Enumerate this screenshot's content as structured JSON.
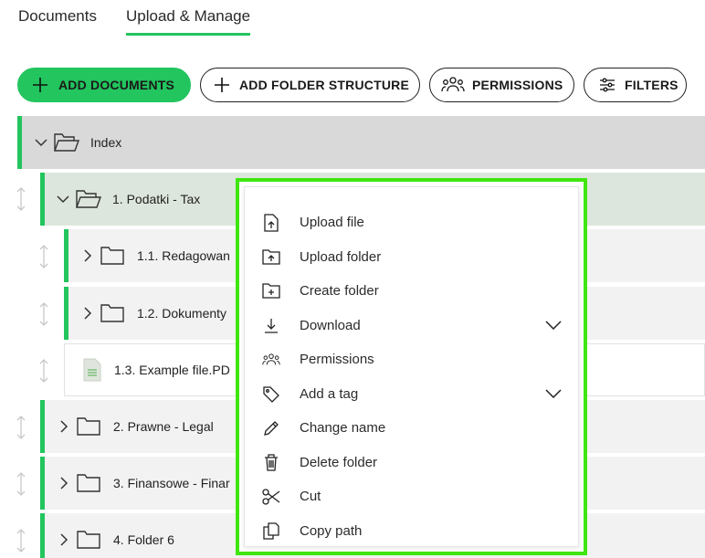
{
  "tabs": [
    {
      "label": "Documents"
    },
    {
      "label": "Upload & Manage"
    }
  ],
  "toolbar": {
    "add_documents": "ADD DOCUMENTS",
    "add_folder_structure": "ADD FOLDER STRUCTURE",
    "permissions": "PERMISSIONS",
    "filters": "FILTERS"
  },
  "tree": {
    "index": "Index",
    "tax": "1. Podatki - Tax",
    "r1": "1.1. Redagowan",
    "r2": "1.2. Dokumenty",
    "file": "1.3. Example file.PD",
    "legal": "2. Prawne - Legal",
    "fin": "3. Finansowe - Finar",
    "f6": "4. Folder 6"
  },
  "menu": {
    "items": [
      {
        "label": "Upload file",
        "icon": "upload-file-icon"
      },
      {
        "label": "Upload folder",
        "icon": "upload-folder-icon"
      },
      {
        "label": "Create folder",
        "icon": "create-folder-icon"
      },
      {
        "label": "Download",
        "icon": "download-icon"
      },
      {
        "label": "Permissions",
        "icon": "users-icon"
      },
      {
        "label": "Add a tag",
        "icon": "tag-icon"
      },
      {
        "label": "Change name",
        "icon": "pencil-icon"
      },
      {
        "label": "Delete folder",
        "icon": "trash-icon"
      },
      {
        "label": "Cut",
        "icon": "scissors-icon"
      },
      {
        "label": "Copy path",
        "icon": "copy-icon"
      }
    ]
  },
  "colors": {
    "accent": "#22c55e",
    "highlight_frame": "#3fe60f",
    "index_row": "#d9d9d9",
    "selected_row": "#dde6dc",
    "row": "#f2f2f2"
  }
}
